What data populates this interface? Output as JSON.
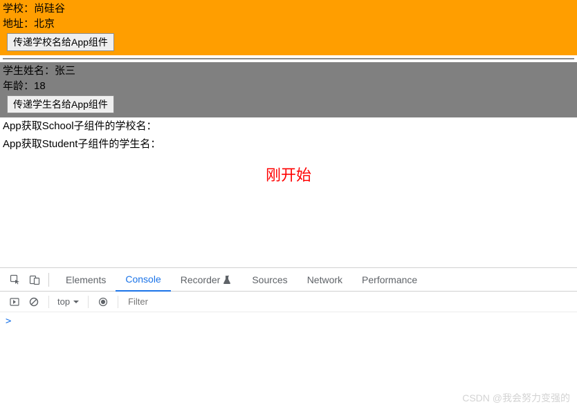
{
  "school": {
    "label_name": "学校：",
    "name": "尚硅谷",
    "label_addr": "地址：",
    "addr": "北京",
    "button_label": "传递学校名给App组件"
  },
  "student": {
    "label_name": "学生姓名：",
    "name": "张三",
    "label_age": "年龄：",
    "age": "18",
    "button_label": "传递学生名给App组件"
  },
  "info": {
    "school_line": "App获取School子组件的学校名：",
    "student_line": "App获取Student子组件的学生名："
  },
  "center_text": "刚开始",
  "devtools": {
    "tabs": {
      "elements": "Elements",
      "console": "Console",
      "recorder": "Recorder",
      "sources": "Sources",
      "network": "Network",
      "performance": "Performance"
    },
    "toolbar": {
      "context": "top",
      "filter_placeholder": "Filter"
    },
    "prompt": ">"
  },
  "watermark": "CSDN @我会努力变强的"
}
